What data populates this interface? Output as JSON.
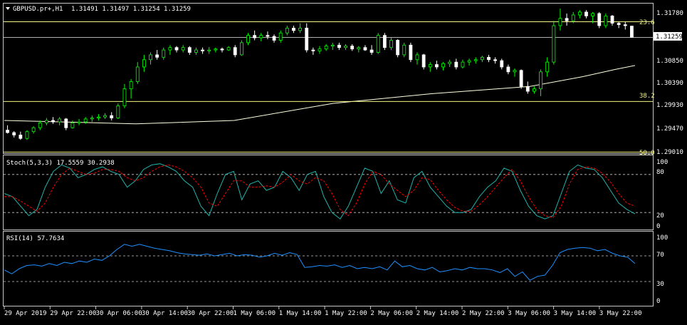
{
  "colors": {
    "background": "#000000",
    "frame": "#c8c8c8",
    "bull_candle": "#00ff00",
    "bear_candle": "#ffffff",
    "moving_average": "#ffffe0",
    "fibo_lines": "#f4f480",
    "stoch_main": "#20b2aa",
    "stoch_signal": "#ff0000",
    "rsi_line": "#1e90ff",
    "level_lines": "#c8c8c8"
  },
  "header": {
    "symbol_label": "GBPUSD.pr+,H1",
    "ohlc": "1.31491 1.31497 1.31254 1.31259"
  },
  "price_panel": {
    "price_ticks": [
      "1.31780",
      "1.30850",
      "1.30390",
      "1.29930",
      "1.29470",
      "1.29010"
    ],
    "fibo_labels": [
      "23.6",
      "38.2",
      "50.0"
    ],
    "current_price": "1.31259"
  },
  "stoch_panel": {
    "title": "Stoch(5,3,3) 17.5559 30.2938",
    "levels": [
      "100",
      "80",
      "20",
      "0"
    ]
  },
  "rsi_panel": {
    "title": "RSI(14) 57.7634",
    "levels": [
      "100",
      "70",
      "30",
      "0"
    ]
  },
  "time_axis": {
    "labels": [
      "29 Apr 2019",
      "29 Apr 22:00",
      "30 Apr 06:00",
      "30 Apr 14:00",
      "30 Apr 22:00",
      "1 May 06:00",
      "1 May 14:00",
      "1 May 22:00",
      "2 May 06:00",
      "2 May 14:00",
      "2 May 22:00",
      "3 May 06:00",
      "3 May 14:00",
      "3 May 22:00"
    ]
  },
  "chart_data": [
    {
      "type": "candlestick",
      "symbol": "GBPUSD.pr+",
      "timeframe": "H1",
      "ylim": [
        1.2889,
        1.3194
      ],
      "y_ticks": [
        1.3178,
        1.3085,
        1.3039,
        1.2993,
        1.2947,
        1.2901
      ],
      "fibo_levels": [
        {
          "label": "23.6",
          "price": 1.3158
        },
        {
          "label": "38.2",
          "price": 1.2994
        },
        {
          "label": "50.0",
          "price": 1.289
        }
      ],
      "current_price_line": 1.31259,
      "candles": [
        [
          1.2935,
          1.2945,
          1.2928,
          1.293
        ],
        [
          1.293,
          1.2933,
          1.292,
          1.2925
        ],
        [
          1.2925,
          1.2932,
          1.2915,
          1.2918
        ],
        [
          1.2918,
          1.2935,
          1.2915,
          1.2932
        ],
        [
          1.2932,
          1.2943,
          1.2928,
          1.294
        ],
        [
          1.294,
          1.2955,
          1.2935,
          1.295
        ],
        [
          1.295,
          1.296,
          1.2945,
          1.2955
        ],
        [
          1.2955,
          1.2962,
          1.2948,
          1.2952
        ],
        [
          1.2952,
          1.2962,
          1.2945,
          1.2958
        ],
        [
          1.2958,
          1.296,
          1.2935,
          1.294
        ],
        [
          1.294,
          1.2955,
          1.2938,
          1.295
        ],
        [
          1.295,
          1.2958,
          1.2945,
          1.2952
        ],
        [
          1.2952,
          1.2962,
          1.2948,
          1.2958
        ],
        [
          1.2958,
          1.2965,
          1.2952,
          1.296
        ],
        [
          1.296,
          1.2968,
          1.2955,
          1.2962
        ],
        [
          1.2962,
          1.297,
          1.2958,
          1.2965
        ],
        [
          1.2965,
          1.2972,
          1.2955,
          1.296
        ],
        [
          1.296,
          1.299,
          1.2958,
          1.2985
        ],
        [
          1.2985,
          1.303,
          1.298,
          1.302
        ],
        [
          1.302,
          1.304,
          1.3,
          1.3035
        ],
        [
          1.3035,
          1.3075,
          1.303,
          1.3065
        ],
        [
          1.3065,
          1.309,
          1.3055,
          1.308
        ],
        [
          1.308,
          1.3095,
          1.307,
          1.309
        ],
        [
          1.309,
          1.31,
          1.308,
          1.3085
        ],
        [
          1.3085,
          1.3105,
          1.308,
          1.31
        ],
        [
          1.31,
          1.311,
          1.309,
          1.3105
        ],
        [
          1.3105,
          1.3108,
          1.3095,
          1.31
        ],
        [
          1.31,
          1.311,
          1.3095,
          1.3105
        ],
        [
          1.3105,
          1.3108,
          1.309,
          1.3095
        ],
        [
          1.3095,
          1.3105,
          1.309,
          1.31
        ],
        [
          1.31,
          1.3105,
          1.3092,
          1.3098
        ],
        [
          1.3098,
          1.3106,
          1.3092,
          1.31
        ],
        [
          1.31,
          1.3105,
          1.3095,
          1.3102
        ],
        [
          1.3102,
          1.3105,
          1.3095,
          1.31
        ],
        [
          1.31,
          1.3108,
          1.3098,
          1.3105
        ],
        [
          1.3105,
          1.311,
          1.3085,
          1.309
        ],
        [
          1.309,
          1.312,
          1.3088,
          1.3115
        ],
        [
          1.3115,
          1.3135,
          1.311,
          1.313
        ],
        [
          1.313,
          1.314,
          1.312,
          1.3125
        ],
        [
          1.3125,
          1.3135,
          1.3118,
          1.313
        ],
        [
          1.313,
          1.3138,
          1.3122,
          1.3128
        ],
        [
          1.3128,
          1.3132,
          1.3115,
          1.312
        ],
        [
          1.312,
          1.314,
          1.3115,
          1.3135
        ],
        [
          1.3135,
          1.315,
          1.313,
          1.3145
        ],
        [
          1.3145,
          1.315,
          1.3135,
          1.314
        ],
        [
          1.314,
          1.3155,
          1.3135,
          1.3145
        ],
        [
          1.3145,
          1.3155,
          1.3095,
          1.31
        ],
        [
          1.31,
          1.3105,
          1.309,
          1.3098
        ],
        [
          1.3098,
          1.3108,
          1.3092,
          1.3102
        ],
        [
          1.3102,
          1.3112,
          1.3098,
          1.3108
        ],
        [
          1.3108,
          1.3115,
          1.31,
          1.311
        ],
        [
          1.311,
          1.3115,
          1.31,
          1.3105
        ],
        [
          1.3105,
          1.3112,
          1.31,
          1.3108
        ],
        [
          1.3108,
          1.3112,
          1.3098,
          1.3102
        ],
        [
          1.3102,
          1.3108,
          1.3095,
          1.3105
        ],
        [
          1.3105,
          1.311,
          1.3098,
          1.31
        ],
        [
          1.31,
          1.311,
          1.309,
          1.3095
        ],
        [
          1.3095,
          1.3135,
          1.3092,
          1.313
        ],
        [
          1.313,
          1.3135,
          1.31,
          1.3105
        ],
        [
          1.3105,
          1.3125,
          1.31,
          1.312
        ],
        [
          1.312,
          1.3122,
          1.3085,
          1.309
        ],
        [
          1.309,
          1.3115,
          1.3085,
          1.311
        ],
        [
          1.311,
          1.3115,
          1.3075,
          1.308
        ],
        [
          1.308,
          1.3095,
          1.307,
          1.309
        ],
        [
          1.309,
          1.3092,
          1.306,
          1.3065
        ],
        [
          1.3065,
          1.3075,
          1.3055,
          1.307
        ],
        [
          1.307,
          1.3078,
          1.306,
          1.3065
        ],
        [
          1.3065,
          1.3075,
          1.3058,
          1.3072
        ],
        [
          1.3072,
          1.308,
          1.3065,
          1.3075
        ],
        [
          1.3075,
          1.3082,
          1.306,
          1.3065
        ],
        [
          1.3065,
          1.308,
          1.3062,
          1.3075
        ],
        [
          1.3075,
          1.3082,
          1.3068,
          1.3078
        ],
        [
          1.3078,
          1.3085,
          1.3072,
          1.308
        ],
        [
          1.308,
          1.3088,
          1.3075,
          1.3085
        ],
        [
          1.3085,
          1.309,
          1.3075,
          1.308
        ],
        [
          1.308,
          1.3085,
          1.3072,
          1.3078
        ],
        [
          1.3078,
          1.3082,
          1.306,
          1.3065
        ],
        [
          1.3065,
          1.307,
          1.305,
          1.3055
        ],
        [
          1.3055,
          1.3062,
          1.3045,
          1.3058
        ],
        [
          1.3058,
          1.306,
          1.302,
          1.3025
        ],
        [
          1.3025,
          1.3035,
          1.301,
          1.3015
        ],
        [
          1.3015,
          1.3025,
          1.301,
          1.302
        ],
        [
          1.302,
          1.306,
          1.3005,
          1.3055
        ],
        [
          1.3055,
          1.3085,
          1.3045,
          1.3075
        ],
        [
          1.3075,
          1.316,
          1.307,
          1.315
        ],
        [
          1.315,
          1.3185,
          1.314,
          1.3165
        ],
        [
          1.3165,
          1.3175,
          1.315,
          1.316
        ],
        [
          1.316,
          1.3178,
          1.3155,
          1.3172
        ],
        [
          1.3172,
          1.3182,
          1.3165,
          1.3178
        ],
        [
          1.3178,
          1.3182,
          1.3165,
          1.317
        ],
        [
          1.317,
          1.3178,
          1.3155,
          1.3175
        ],
        [
          1.3175,
          1.3178,
          1.3145,
          1.315
        ],
        [
          1.315,
          1.3175,
          1.3145,
          1.317
        ],
        [
          1.317,
          1.3172,
          1.315,
          1.3155
        ],
        [
          1.3155,
          1.3158,
          1.3145,
          1.3152
        ],
        [
          1.3152,
          1.3158,
          1.3142,
          1.315
        ],
        [
          1.31491,
          1.31497,
          1.31254,
          1.31259
        ]
      ],
      "moving_average": [
        [
          0,
          1.2955
        ],
        [
          20,
          1.2948
        ],
        [
          35,
          1.2955
        ],
        [
          50,
          1.299
        ],
        [
          65,
          1.301
        ],
        [
          80,
          1.3025
        ],
        [
          88,
          1.3045
        ],
        [
          93,
          1.306
        ],
        [
          96,
          1.3068
        ]
      ]
    },
    {
      "type": "line",
      "title": "Stoch(5,3,3) 17.5559 30.2938",
      "ylim": [
        0,
        100
      ],
      "levels": [
        80,
        20
      ],
      "series": [
        {
          "values": [
            50,
            45,
            30,
            15,
            25,
            60,
            85,
            95,
            90,
            75,
            80,
            88,
            92,
            85,
            80,
            60,
            70,
            88,
            95,
            97,
            92,
            85,
            70,
            60,
            30,
            15,
            50,
            80,
            85,
            40,
            65,
            70,
            55,
            60,
            85,
            75,
            55,
            80,
            85,
            45,
            20,
            10,
            30,
            60,
            90,
            85,
            50,
            70,
            40,
            35,
            75,
            85,
            60,
            45,
            30,
            20,
            20,
            25,
            45,
            60,
            70,
            90,
            85,
            55,
            30,
            15,
            10,
            15,
            50,
            85,
            95,
            90,
            88,
            75,
            55,
            35,
            25,
            18
          ]
        },
        {
          "name": "signal",
          "values": [
            45,
            45,
            38,
            30,
            22,
            35,
            60,
            80,
            90,
            85,
            80,
            82,
            88,
            88,
            85,
            75,
            70,
            75,
            85,
            92,
            95,
            92,
            85,
            75,
            60,
            35,
            30,
            50,
            70,
            70,
            60,
            60,
            62,
            60,
            68,
            80,
            70,
            65,
            75,
            70,
            50,
            25,
            15,
            35,
            65,
            85,
            80,
            65,
            55,
            45,
            55,
            75,
            72,
            55,
            40,
            28,
            22,
            22,
            32,
            45,
            60,
            75,
            88,
            70,
            45,
            25,
            15,
            12,
            30,
            65,
            88,
            92,
            90,
            82,
            68,
            50,
            35,
            30
          ]
        }
      ]
    },
    {
      "type": "line",
      "title": "RSI(14) 57.7634",
      "ylim": [
        0,
        100
      ],
      "levels": [
        70,
        30
      ],
      "series": [
        {
          "values": [
            48,
            42,
            50,
            55,
            56,
            54,
            58,
            55,
            60,
            58,
            62,
            60,
            65,
            63,
            70,
            80,
            88,
            85,
            88,
            85,
            82,
            80,
            78,
            75,
            73,
            72,
            71,
            73,
            70,
            72,
            74,
            70,
            72,
            71,
            68,
            70,
            74,
            71,
            75,
            72,
            52,
            53,
            55,
            54,
            56,
            52,
            55,
            50,
            52,
            50,
            53,
            48,
            62,
            53,
            55,
            50,
            48,
            52,
            45,
            47,
            50,
            48,
            52,
            50,
            50,
            48,
            44,
            50,
            38,
            45,
            32,
            38,
            40,
            55,
            75,
            80,
            82,
            83,
            82,
            78,
            80,
            74,
            70,
            68,
            58
          ]
        }
      ]
    }
  ]
}
